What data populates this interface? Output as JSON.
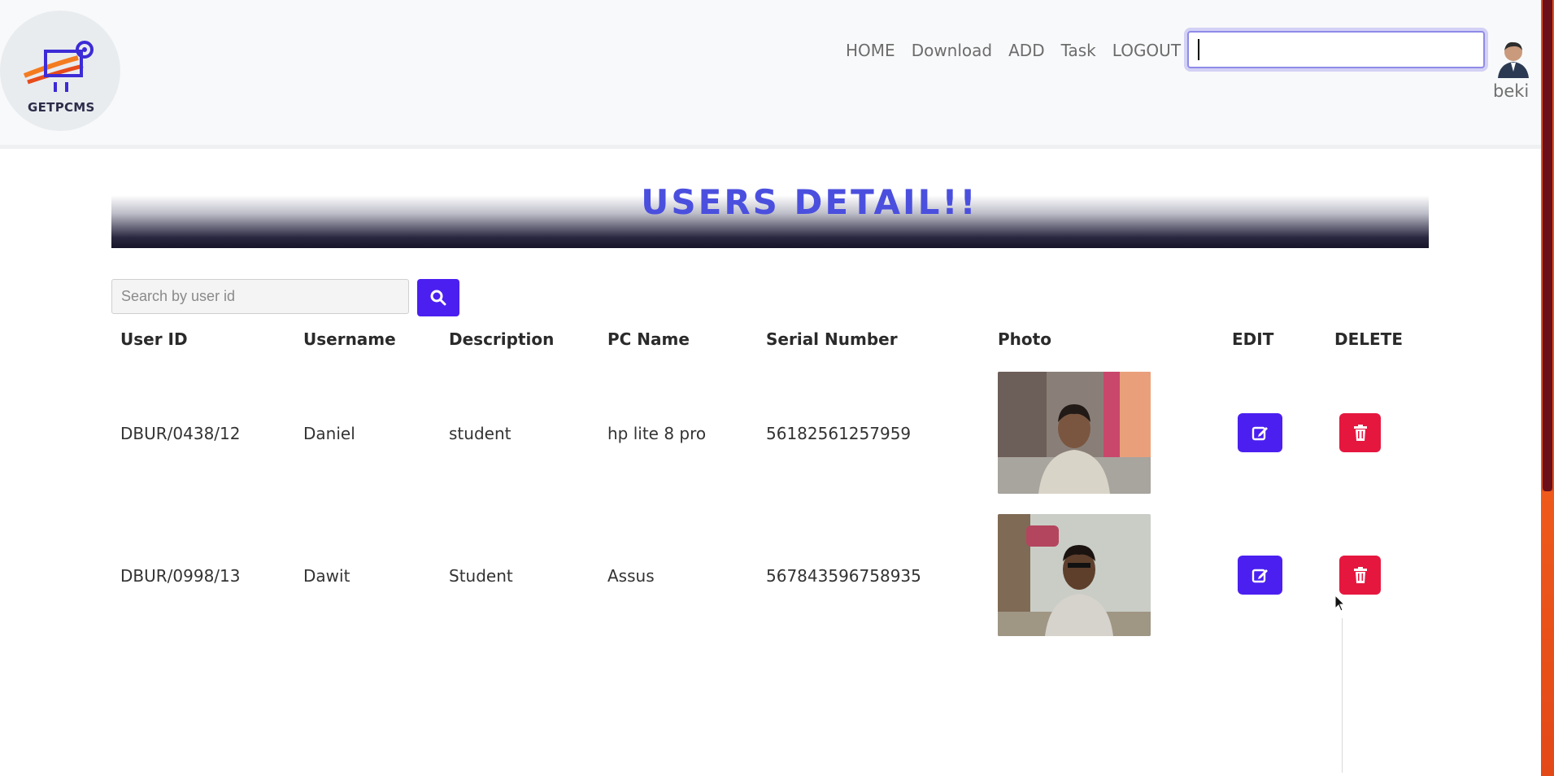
{
  "brand": {
    "name": "GETPCMS"
  },
  "nav": {
    "items": [
      "HOME",
      "Download",
      "ADD",
      "Task",
      "LOGOUT"
    ]
  },
  "top_search": {
    "value": ""
  },
  "user": {
    "name": "beki"
  },
  "page": {
    "title": "USERS DETAIL!!"
  },
  "user_search": {
    "placeholder": "Search by user id"
  },
  "table": {
    "headers": [
      "User ID",
      "Username",
      "Description",
      "PC Name",
      "Serial Number",
      "Photo",
      "EDIT",
      "DELETE"
    ],
    "rows": [
      {
        "user_id": "DBUR/0438/12",
        "username": "Daniel",
        "description": "student",
        "pc_name": "hp lite 8 pro",
        "serial": "56182561257959"
      },
      {
        "user_id": "DBUR/0998/13",
        "username": "Dawit",
        "description": "Student",
        "pc_name": "Assus",
        "serial": "567843596758935"
      }
    ]
  },
  "colors": {
    "accent": "#4b1ff0",
    "danger": "#e5173f",
    "title": "#4b4fde"
  },
  "icons": {
    "search": "search-icon",
    "edit": "edit-icon",
    "delete": "trash-icon"
  }
}
